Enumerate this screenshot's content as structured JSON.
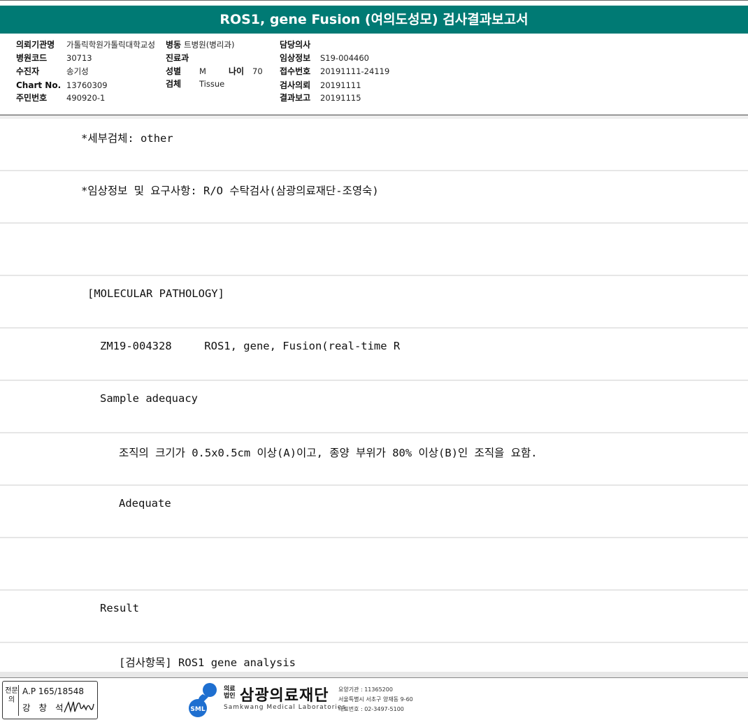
{
  "header": {
    "title": "ROS1, gene Fusion (여의도성모) 검사결과보고서"
  },
  "info": {
    "institution_label": "의뢰기관명",
    "institution_value": "가톨릭학원가톨릭대학교성",
    "ward_label": "병동",
    "ward_value": "트병원(병리과)",
    "hospital_code_label": "병원코드",
    "hospital_code_value": "30713",
    "dept_label": "진료과",
    "dept_value": "",
    "patient_label": "수진자",
    "patient_value": "송기성",
    "sex_label": "성별",
    "sex_value": "M",
    "age_label": "나이",
    "age_value": "70",
    "chart_label": "Chart No.",
    "chart_value": "13760309",
    "specimen_label": "검체",
    "specimen_value": "Tissue",
    "resident_label": "주민번호",
    "resident_value": "490920-1",
    "doctor_label": "담당의사",
    "doctor_value": "",
    "clinical_label": "임상정보",
    "clinical_value": "S19-004460",
    "receipt_label": "접수번호",
    "receipt_value": "20191111-24119",
    "request_label": "검사의뢰",
    "request_value": "20191111",
    "report_label": "결과보고",
    "report_value": "20191115"
  },
  "rows": [
    {
      "indent": "ind1",
      "text": "*세부검체: other"
    },
    {
      "indent": "ind1",
      "text": "*임상정보 및 요구사항: R/O 수탁검사(삼광의료재단-조영숙)"
    },
    {
      "indent": "ind1",
      "text": ""
    },
    {
      "indent": "ind2",
      "text": "[MOLECULAR PATHOLOGY]"
    },
    {
      "indent": "ind3",
      "text": "ZM19-004328     ROS1, gene, Fusion(real-time R"
    },
    {
      "indent": "ind3",
      "text": "Sample adequacy"
    },
    {
      "indent": "ind4",
      "text": "조직의 크기가 0.5x0.5cm 이상(A)이고, 종양 부위가 80% 이상(B)인 조직을 요함."
    },
    {
      "indent": "ind4",
      "text": "Adequate"
    },
    {
      "indent": "ind4",
      "text": ""
    },
    {
      "indent": "ind3",
      "text": "Result"
    },
    {
      "indent": "ind4",
      "text": "[검사항목] ROS1 gene analysis"
    }
  ],
  "footer": {
    "signature": {
      "vertical_label": "전문의",
      "ap_number": "A.P 165/18548",
      "name": "강 창 석"
    },
    "logo": {
      "corp_line1": "의료",
      "corp_line2": "법인",
      "mark_text": "SML",
      "name": "삼광의료재단",
      "english": "Samkwang Medical Laboratories",
      "detail_1": "요양기관 : 11365200",
      "detail_2": "서울특별시 서초구 양재동 9-60",
      "detail_3": "대표번호 : 02-3497-5100"
    }
  },
  "colors": {
    "title_bar": "#007a74",
    "logo_blue": "#1e6fd0"
  }
}
